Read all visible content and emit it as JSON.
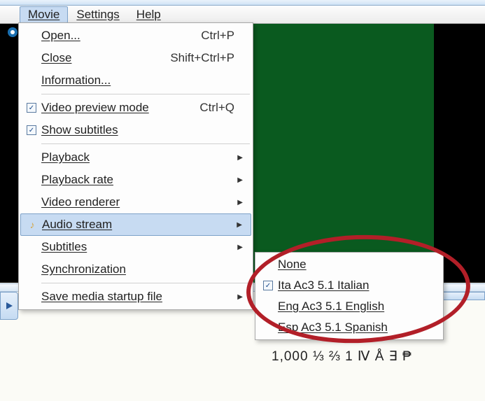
{
  "menubar": {
    "items": [
      "Movie",
      "Settings",
      "Help"
    ]
  },
  "menu": {
    "open": {
      "label": "Open...",
      "shortcut": "Ctrl+P"
    },
    "close": {
      "label": "Close",
      "shortcut": "Shift+Ctrl+P"
    },
    "information": {
      "label": "Information..."
    },
    "video_preview": {
      "label": "Video preview mode",
      "shortcut": "Ctrl+Q",
      "checked": true
    },
    "show_subtitles": {
      "label": "Show subtitles",
      "checked": true
    },
    "playback": {
      "label": "Playback"
    },
    "playback_rate": {
      "label": "Playback rate"
    },
    "video_renderer": {
      "label": "Video renderer"
    },
    "audio_stream": {
      "label": "Audio stream"
    },
    "subtitles": {
      "label": "Subtitles"
    },
    "synchronization": {
      "label": "Synchronization"
    },
    "save_media": {
      "label": "Save media startup file"
    }
  },
  "submenu": {
    "none": {
      "label": "None"
    },
    "ita": {
      "label": "Ita Ac3 5.1 Italian",
      "checked": true
    },
    "eng": {
      "label": "Eng Ac3 5.1 English"
    },
    "esp": {
      "label": "Esp Ac3 5.1 Spanish"
    }
  },
  "bottom_text": "1,000  ⅓ ⅔ 1 Ⅳ Å ∃ ₱"
}
